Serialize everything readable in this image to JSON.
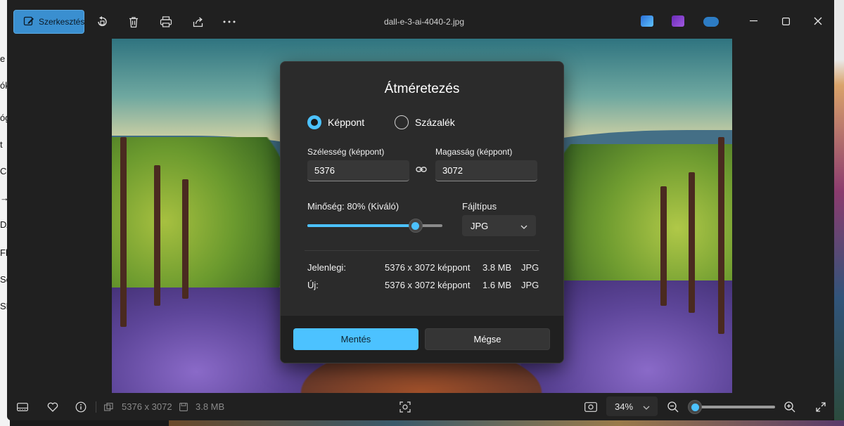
{
  "window": {
    "filename": "dall-e-3-ai-4040-2.jpg",
    "edit_button_label": "Szerkesztés"
  },
  "desktop_left_fragments": [
    "e sz",
    "ók",
    "óg",
    "t",
    "Co",
    "→",
    "DA",
    "Flu",
    "Scr",
    "SD"
  ],
  "dialog": {
    "title": "Átméretezés",
    "radio_pixels": "Képpont",
    "radio_percent": "Százalék",
    "width_label": "Szélesség (képpont)",
    "width_value": "5376",
    "height_label": "Magasság (képpont)",
    "height_value": "3072",
    "quality_label": "Minőség: 80% (Kiváló)",
    "quality_value": 0.8,
    "filetype_label": "Fájltípus",
    "filetype_value": "JPG",
    "current_label": "Jelenlegi:",
    "current_dims": "5376 x 3072 képpont",
    "current_size": "3.8 MB",
    "current_type": "JPG",
    "new_label": "Új:",
    "new_dims": "5376 x 3072 képpont",
    "new_size": "1.6 MB",
    "new_type": "JPG",
    "save_label": "Mentés",
    "cancel_label": "Mégse"
  },
  "statusbar": {
    "dimensions": "5376 x 3072",
    "filesize": "3.8 MB",
    "zoom": "34%",
    "zoom_level": 0.05
  },
  "colors": {
    "accent": "#4cc2ff",
    "edit_button": "#3a8fd0",
    "dialog_bg": "#2b2b2b",
    "app_bg": "#202020"
  }
}
